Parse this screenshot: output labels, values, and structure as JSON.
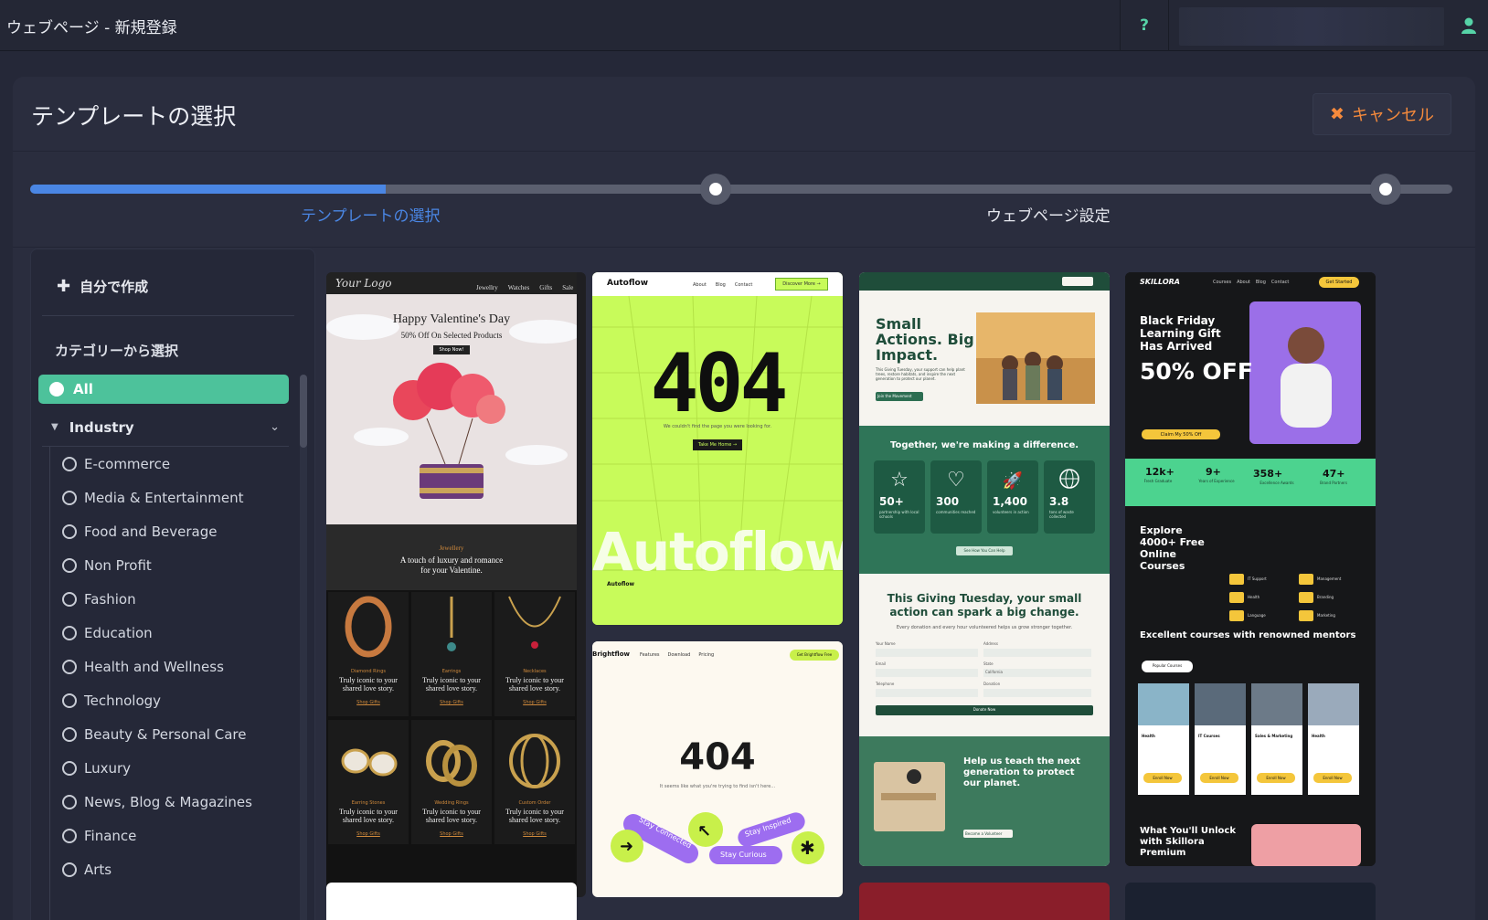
{
  "app": {
    "title": "ウェブページ - 新規登録",
    "help": "?"
  },
  "panel": {
    "title": "テンプレートの選択",
    "cancel_label": "キャンセル",
    "cancel_icon": "✖"
  },
  "stepper": {
    "progress": 0.25,
    "steps": [
      {
        "label": "テンプレートの選択",
        "active": true
      },
      {
        "label": "ウェブページ設定",
        "active": false
      }
    ],
    "accent": "#4a86e4"
  },
  "sidebar": {
    "create_label": "自分で作成",
    "category_heading": "カテゴリーから選択",
    "all_label": "All",
    "group_label": "Industry",
    "options": [
      "E-commerce",
      "Media & Entertainment",
      "Food and Beverage",
      "Non Profit",
      "Fashion",
      "Education",
      "Health and Wellness",
      "Technology",
      "Beauty & Personal Care",
      "Luxury",
      "News, Blog & Magazines",
      "Finance",
      "Arts"
    ]
  },
  "templates": {
    "valentine": {
      "logo": "Your Logo",
      "nav": [
        "Jewellry",
        "Watches",
        "Gifts",
        "Sale"
      ],
      "headline": "Happy Valentine's Day",
      "sub": "50% Off On Selected Products",
      "cta": "Shop Now!",
      "section_kicker": "Jewellery",
      "section_title": "A touch of luxury and romance",
      "section_title2": "for your Valentine.",
      "products": [
        "Diamond Rings",
        "Earrings",
        "Necklaces",
        "Earring Stones",
        "Wedding Rings",
        "Custom Order"
      ],
      "product_text": "Truly iconic to your shared love story.",
      "product_link": "Shop Gifts"
    },
    "autoflow": {
      "brand": "Autoflow",
      "nav": [
        "About",
        "Blog",
        "Contact"
      ],
      "cta": "Discover More →",
      "code": "404",
      "message": "We couldn't find the page you were looking for.",
      "button": "Take Me Home →",
      "wordmark": "Autoflow"
    },
    "brightflow": {
      "brand": "Brightflow",
      "nav": [
        "Features",
        "Download",
        "Pricing"
      ],
      "cta": "Get Brightflow Free",
      "code": "404",
      "message": "It seems like what you're trying to find isn't here...",
      "pills": [
        "Stay Connected",
        "Stay Inspired",
        "Stay Curious"
      ]
    },
    "giving": {
      "headline": "Small Actions. Big Impact.",
      "sub": "This Giving Tuesday, your support can help plant trees, restore habitats, and inspire the next generation to protect our planet.",
      "button": "Join the Movement",
      "band": "Together, we're making a difference.",
      "stats": [
        {
          "value": "50+",
          "label": "partnership with local schools"
        },
        {
          "value": "300",
          "label": "communities reached"
        },
        {
          "value": "1,400",
          "label": "volunteers in action"
        },
        {
          "value": "3.8",
          "label": "tons of waste collected"
        }
      ],
      "band_button": "See How You Can Help",
      "form_title": "This Giving Tuesday, your small action can spark a big change.",
      "form_sub": "Every donation and every hour volunteered helps us grow stronger together.",
      "fields": [
        "Your Name",
        "Address",
        "Email",
        "State",
        "Telephone",
        "Donation"
      ],
      "state_value": "California",
      "form_button": "Donate Now",
      "foot_title": "Help us teach the next generation to protect our planet.",
      "foot_button": "Become a Volunteer"
    },
    "skillora": {
      "brand": "SKILLORA",
      "nav": [
        "Courses",
        "About",
        "Blog",
        "Contact"
      ],
      "cta": "Get Started",
      "headline": "Black Friday Learning Gift Has Arrived",
      "offer": "50% OFF",
      "claim": "Claim My 50% Off",
      "stats": [
        {
          "value": "12k+",
          "label": "Fresh Graduate"
        },
        {
          "value": "9+",
          "label": "Years of Experience"
        },
        {
          "value": "358+",
          "label": "Excellence Awards"
        },
        {
          "value": "47+",
          "label": "Brand Partners"
        }
      ],
      "explore": "Explore 4000+ Free Online Courses",
      "cats": [
        "IT Support",
        "Management",
        "Health",
        "Branding",
        "Language",
        "Marketing"
      ],
      "mentors": "Excellent courses with renowned mentors",
      "pill": "Popular Courses",
      "courses": [
        "Health",
        "IT Courses",
        "Sales & Marketing",
        "Health"
      ],
      "enroll": "Enroll Now",
      "unlock": "What You'll Unlock with Skillora Premium"
    }
  }
}
